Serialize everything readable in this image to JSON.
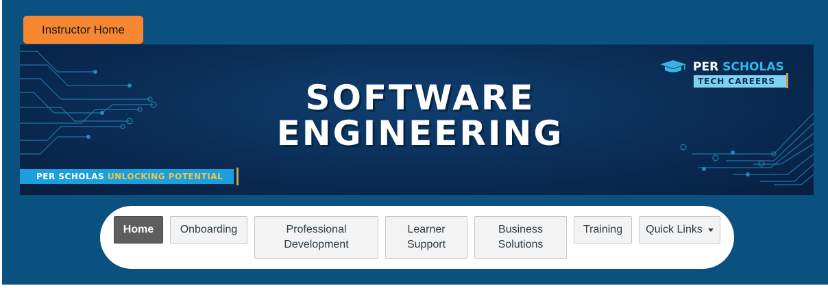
{
  "header": {
    "instructor_home_label": "Instructor Home"
  },
  "banner": {
    "title_line1": "SOFTWARE",
    "title_line2": "ENGINEERING",
    "logo_per": "PER",
    "logo_scholas": "SCHOLAS",
    "logo_tech_careers": "TECH CAREERS",
    "tagline_per_scholas": "PER SCHOLAS",
    "tagline_unlocking": "UNLOCKING POTENTIAL"
  },
  "nav": {
    "items": [
      {
        "label": "Home",
        "active": true
      },
      {
        "label": "Onboarding"
      },
      {
        "label": "Professional Development"
      },
      {
        "label": "Learner Support"
      },
      {
        "label": "Business Solutions"
      },
      {
        "label": "Training"
      },
      {
        "label": "Quick Links",
        "has_dropdown": true
      }
    ]
  },
  "icons": {
    "logo": "graduation-cap-icon",
    "dropdown": "caret-down-icon"
  },
  "colors": {
    "panel_blue": "#0b5180",
    "instructor_orange": "#f6862f",
    "banner_navy": "#0a2c55",
    "accent_cyan": "#39b4e6",
    "tagline_blue": "#1ba0df",
    "tagline_yellow": "#f3c343",
    "nav_active": "#5e5e5e"
  }
}
